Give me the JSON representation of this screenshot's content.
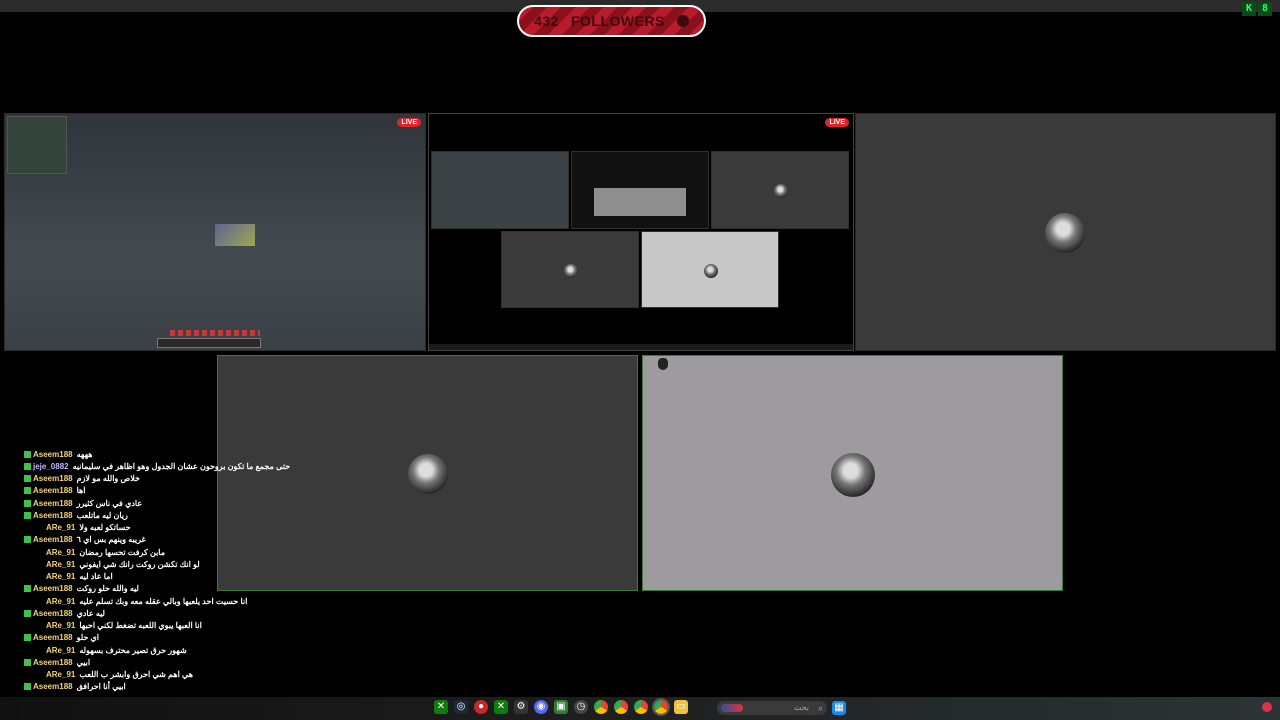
{
  "overlay": {
    "followers_count": "432",
    "followers_label": "FOLLOWERS",
    "tray": [
      "K",
      "8"
    ]
  },
  "tiles": {
    "live_badge": "LIVE"
  },
  "chat": [
    {
      "user": "Aseem188",
      "msg": "هههه"
    },
    {
      "user": "jeje_0882",
      "msg": "حتى مجمع ما تكون بروحون عشان الجدول وهو اظاهر في سليمانيه"
    },
    {
      "user": "Aseem188",
      "msg": "خلاص والله مو لازم"
    },
    {
      "user": "Aseem188",
      "msg": "اها"
    },
    {
      "user": "Aseem188",
      "msg": "عادي في ناس كثيرر"
    },
    {
      "user": "Aseem188",
      "msg": "ريان ليه ماتلعب"
    },
    {
      "user": "ARe_91",
      "msg": "حساتكو لعبه ولا"
    },
    {
      "user": "Aseem188",
      "msg": "غريبه وينهم بس اي ٦"
    },
    {
      "user": "ARe_91",
      "msg": "مابن كرفت تحسها رمضان"
    },
    {
      "user": "ARe_91",
      "msg": "لو انك تكشن روكت رانك شي ايفوني"
    },
    {
      "user": "ARe_91",
      "msg": "اما عاد ليه"
    },
    {
      "user": "Aseem188",
      "msg": "ليه والله حلو روكت"
    },
    {
      "user": "ARe_91",
      "msg": "انا حسيت احد يلعبها وبالي عقله معه وبك تسلم عليه"
    },
    {
      "user": "Aseem188",
      "msg": "ليه عادي"
    },
    {
      "user": "ARe_91",
      "msg": "انا العبها يبوي اللعبه تضغط لكني احبها"
    },
    {
      "user": "Aseem188",
      "msg": "اي حلو"
    },
    {
      "user": "ARe_91",
      "msg": "شهور حرق تصير محترف بسهوله"
    },
    {
      "user": "Aseem188",
      "msg": "ابيي"
    },
    {
      "user": "ARe_91",
      "msg": "هي اهم شي احرق وابشر ب اللعب"
    },
    {
      "user": "Aseem188",
      "msg": "ابيي أنا احرافق"
    }
  ],
  "dock": {
    "search_placeholder": "بحث",
    "icons": [
      "xbox-icon",
      "steam-icon",
      "record-icon",
      "xbox-icon",
      "settings-icon",
      "discord-icon",
      "app-icon",
      "clock-icon",
      "chrome-icon",
      "chrome-icon",
      "chrome-icon",
      "chrome-icon",
      "folder-icon"
    ]
  }
}
